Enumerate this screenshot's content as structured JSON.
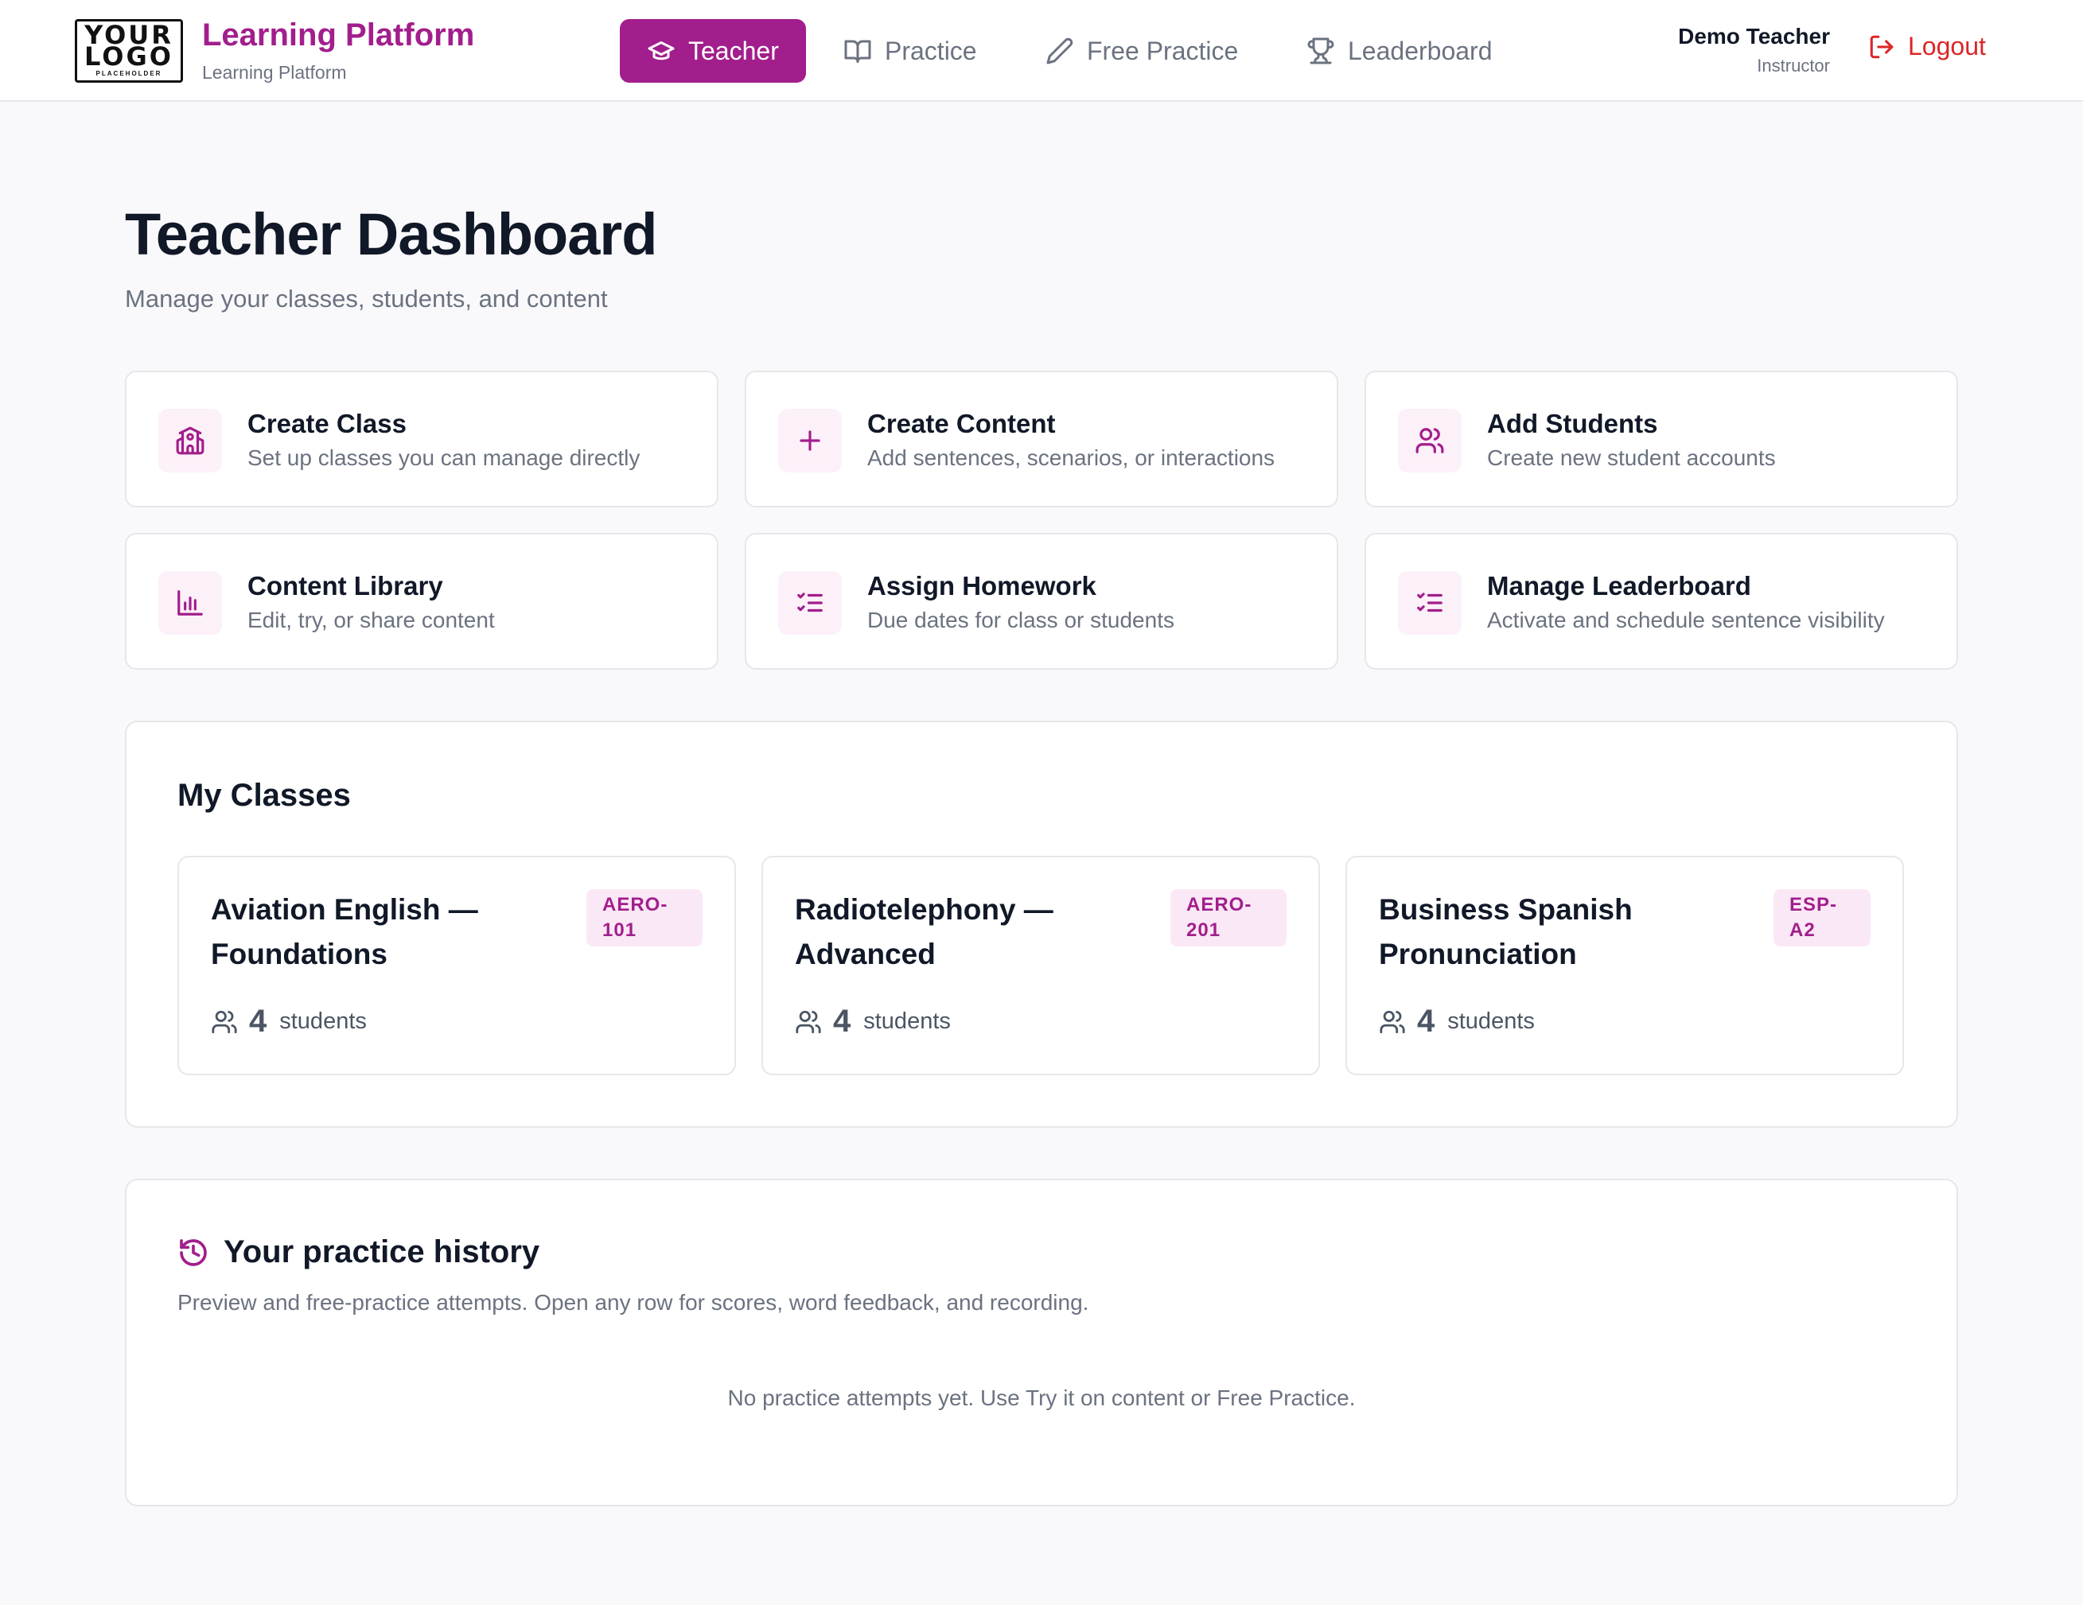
{
  "header": {
    "logo": {
      "line1": "YOUR",
      "line2": "LOGO",
      "line3": "PLACEHOLDER"
    },
    "brand_title": "Learning Platform",
    "brand_subtitle": "Learning Platform",
    "nav": [
      {
        "label": "Teacher",
        "icon": "graduation-cap-icon",
        "active": true
      },
      {
        "label": "Practice",
        "icon": "book-open-icon",
        "active": false
      },
      {
        "label": "Free Practice",
        "icon": "pencil-icon",
        "active": false
      },
      {
        "label": "Leaderboard",
        "icon": "trophy-icon",
        "active": false
      }
    ],
    "user": {
      "name": "Demo Teacher",
      "role": "Instructor"
    },
    "logout_label": "Logout"
  },
  "page": {
    "title": "Teacher Dashboard",
    "subtitle": "Manage your classes, students, and content"
  },
  "actions": [
    {
      "title": "Create Class",
      "description": "Set up classes you can manage directly",
      "icon": "school-icon"
    },
    {
      "title": "Create Content",
      "description": "Add sentences, scenarios, or interactions",
      "icon": "plus-icon"
    },
    {
      "title": "Add Students",
      "description": "Create new student accounts",
      "icon": "users-icon"
    },
    {
      "title": "Content Library",
      "description": "Edit, try, or share content",
      "icon": "bar-chart-icon"
    },
    {
      "title": "Assign Homework",
      "description": "Due dates for class or students",
      "icon": "list-checks-icon"
    },
    {
      "title": "Manage Leaderboard",
      "description": "Activate and schedule sentence visibility",
      "icon": "list-checks-icon"
    }
  ],
  "classes": {
    "title": "My Classes",
    "items": [
      {
        "name": "Aviation English — Foundations",
        "code": "AERO-101",
        "student_count": "4",
        "student_label": "students"
      },
      {
        "name": "Radiotelephony — Advanced",
        "code": "AERO-201",
        "student_count": "4",
        "student_label": "students"
      },
      {
        "name": "Business Spanish Pronunciation",
        "code": "ESP-A2",
        "student_count": "4",
        "student_label": "students"
      }
    ]
  },
  "history": {
    "title": "Your practice history",
    "description": "Preview and free-practice attempts. Open any row for scores, word feedback, and recording.",
    "empty_message": "No practice attempts yet. Use Try it on content or Free Practice."
  },
  "colors": {
    "accent": "#a21e8c",
    "accent_soft": "#fcf0f9",
    "danger": "#dc2626",
    "background": "#f9f9fb"
  }
}
